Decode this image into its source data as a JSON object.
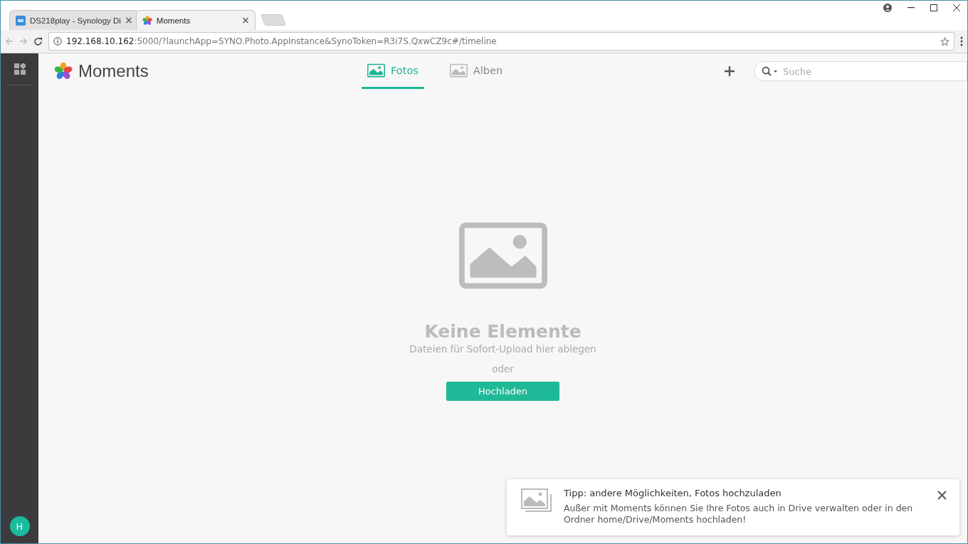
{
  "browser": {
    "tabs": [
      {
        "title": "DS218play - Synology Di",
        "kind": "dsm",
        "selected": false
      },
      {
        "title": "Moments",
        "kind": "moments",
        "selected": true
      }
    ],
    "url": {
      "host": "192.168.10.162",
      "rest": ":5000/?launchApp=SYNO.Photo.AppInstance&SynoToken=R3i7S.QxwCZ9c#/timeline"
    }
  },
  "sidebar": {
    "avatar": "H"
  },
  "app": {
    "title": "Moments",
    "nav": [
      {
        "label": "Fotos",
        "selected": true
      },
      {
        "label": "Alben",
        "selected": false
      }
    ],
    "search": {
      "placeholder": "Suche"
    }
  },
  "empty": {
    "title": "Keine Elemente",
    "hint": "Dateien für Sofort-Upload hier ablegen",
    "or": "oder",
    "button": "Hochladen"
  },
  "toast": {
    "title": "Tipp: andere Möglichkeiten, Fotos hochzuladen",
    "body": "Außer mit Moments können Sie Ihre Fotos auch in Drive verwalten oder in den Ordner home/Drive/Moments hochladen!"
  }
}
